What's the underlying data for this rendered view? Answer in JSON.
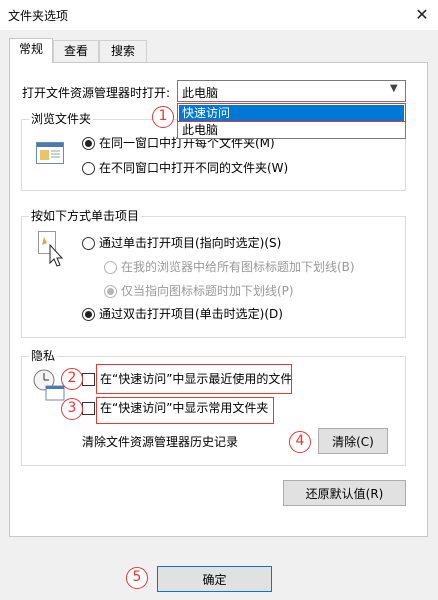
{
  "window": {
    "title": "文件夹选项",
    "close_glyph": "✕"
  },
  "tabs": [
    {
      "label": "常规",
      "active": true
    },
    {
      "label": "查看",
      "active": false
    },
    {
      "label": "搜索",
      "active": false
    }
  ],
  "open_with": {
    "label": "打开文件资源管理器时打开:",
    "selected": "此电脑",
    "options": [
      "快速访问",
      "此电脑"
    ],
    "highlighted": "快速访问"
  },
  "browse_folders": {
    "title": "浏览文件夹",
    "same_window": "在同一窗口中打开每个文件夹(M)",
    "new_window": "在不同窗口中打开不同的文件夹(W)"
  },
  "click_items": {
    "title": "按如下方式单击项目",
    "single_click": "通过单击打开项目(指向时选定)(S)",
    "underline_browser": "在我的浏览器中给所有图标标题加下划线(B)",
    "underline_pointing": "仅当指向图标标题时加下划线(P)",
    "double_click": "通过双击打开项目(单击时选定)(D)"
  },
  "privacy": {
    "title": "隐私",
    "show_recent": "在“快速访问”中显示最近使用的文件",
    "show_frequent": "在“快速访问”中显示常用文件夹",
    "clear_history_label": "清除文件资源管理器历史记录",
    "clear_button": "清除(C)"
  },
  "restore_defaults": "还原默认值(R)",
  "ok_button": "确定",
  "annotations": [
    "1",
    "2",
    "3",
    "4",
    "5"
  ],
  "colors": {
    "annotation": "#e53935",
    "selection": "#0078d7"
  }
}
